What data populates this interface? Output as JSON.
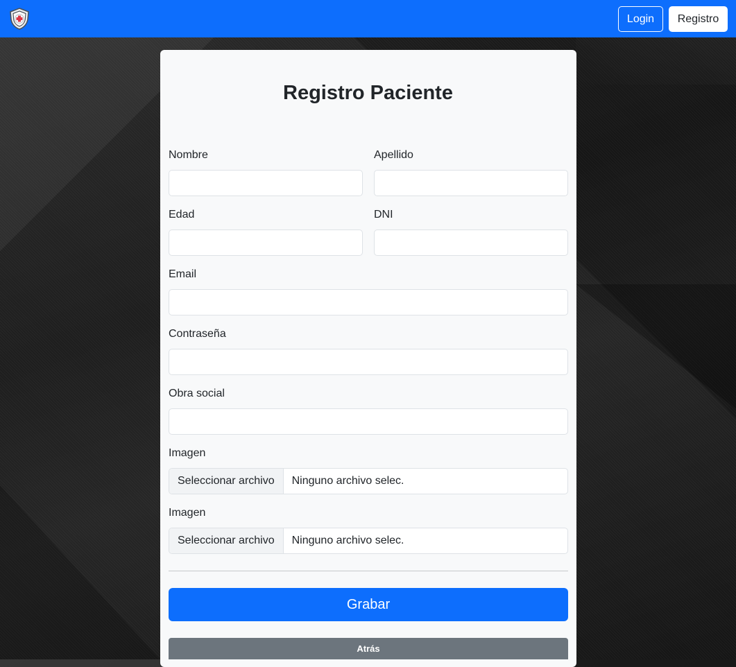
{
  "navbar": {
    "logo_icon": "shield-medical-cross-icon",
    "login_label": "Login",
    "registro_label": "Registro",
    "background_color": "#0d6efd"
  },
  "form": {
    "title": "Registro Paciente",
    "fields": {
      "nombre": {
        "label": "Nombre",
        "value": ""
      },
      "apellido": {
        "label": "Apellido",
        "value": ""
      },
      "edad": {
        "label": "Edad",
        "value": ""
      },
      "dni": {
        "label": "DNI",
        "value": ""
      },
      "email": {
        "label": "Email",
        "value": ""
      },
      "password": {
        "label": "Contraseña",
        "value": ""
      },
      "obra_social": {
        "label": "Obra social",
        "value": ""
      },
      "imagen1": {
        "label": "Imagen",
        "button": "Seleccionar archivo",
        "status": "Ninguno archivo selec."
      },
      "imagen2": {
        "label": "Imagen",
        "button": "Seleccionar archivo",
        "status": "Ninguno archivo selec."
      }
    },
    "submit_label": "Grabar",
    "back_label": "Atrás"
  },
  "colors": {
    "primary": "#0d6efd",
    "secondary": "#6c757d",
    "card_background": "#f8f9fa"
  }
}
